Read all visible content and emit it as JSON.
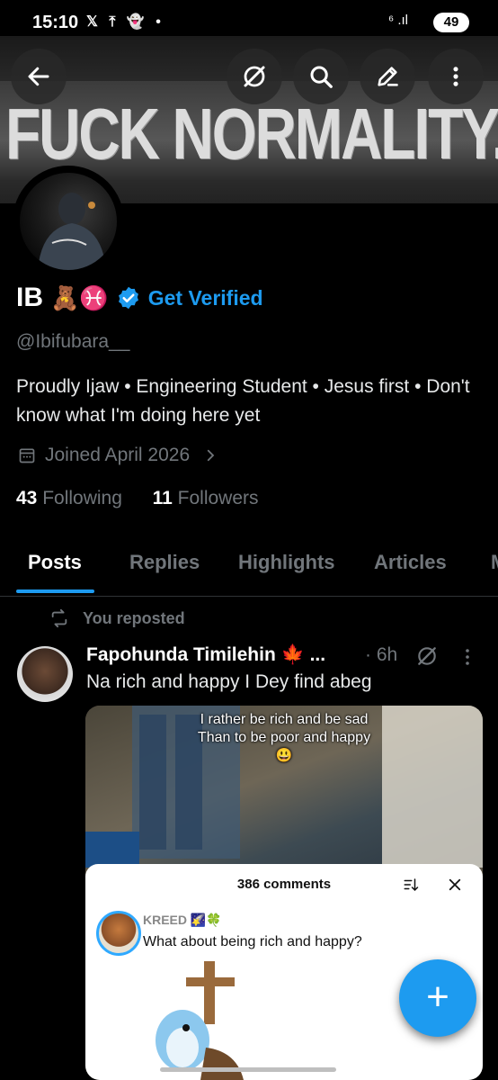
{
  "status_bar": {
    "time": "15:10",
    "notif_icons": "𝕏 ⤒ 👻 •",
    "signal": "⁶ .ıl",
    "battery": "49"
  },
  "header": {
    "banner_text": "FUCK NORMALITY."
  },
  "profile": {
    "name": "IB",
    "name_emojis": "🧸♓",
    "get_verified_label": "Get Verified",
    "handle": "@Ibifubara__",
    "bio": "Proudly Ijaw • Engineering Student • Jesus first • Don't know what I'm doing here yet",
    "joined": "Joined April 2026",
    "following_count": "43",
    "following_label": "Following",
    "followers_count": "11",
    "followers_label": "Followers"
  },
  "tabs": [
    {
      "label": "Posts"
    },
    {
      "label": "Replies"
    },
    {
      "label": "Highlights"
    },
    {
      "label": "Articles"
    },
    {
      "label": "M"
    }
  ],
  "post": {
    "repost_label": "You reposted",
    "author": "Fapohunda Timilehin 🍁 ...",
    "time": "· 6h",
    "text": "Na rich and happy I Dey find abeg",
    "media": {
      "caption_line1": "I rather be rich and be sad",
      "caption_line2": "Than to be poor and happy",
      "caption_emoji": "😃",
      "comments_title": "386 comments",
      "comment_user": "KREED 🌠🍀",
      "comment_text": "What about being rich and happy?"
    }
  },
  "fab_label": "+",
  "colors": {
    "accent": "#1d9bf0",
    "background": "#000000",
    "muted": "#71767b"
  }
}
